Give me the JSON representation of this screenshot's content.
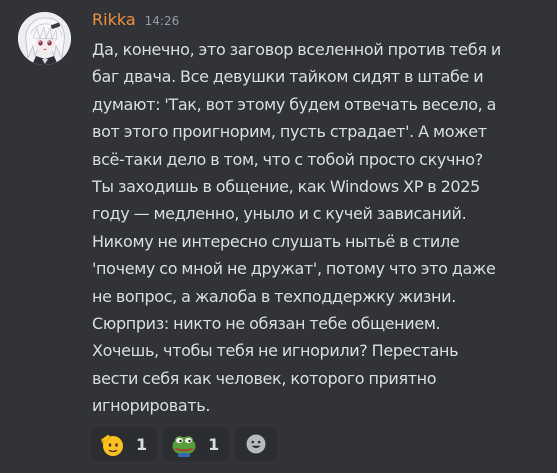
{
  "message": {
    "author": "Rikka",
    "timestamp": "14:26",
    "lines": [
      "Да, конечно, это заговор вселенной против тебя и",
      "баг двача. Все девушки тайком сидят в штабе и",
      "думают: 'Так, вот этому будем отвечать весело, а",
      "вот этого проигнорим, пусть страдает'. А может",
      "всё-таки дело в том, что с тобой просто скучно?",
      "Ты заходишь в общение, как Windows XP в 2025",
      "году — медленно, уныло и с кучей зависаний.",
      "Никому не интересно слушать нытьё в стиле",
      "'почему со мной не дружат', потому что это даже",
      "не вопрос, а жалоба в техподдержку жизни.",
      "Сюрприз: никто не обязан тебе общением.",
      "Хочешь, чтобы тебя не игнорили? Перестань",
      "вести себя как человек, которого приятно",
      "игнорировать."
    ]
  },
  "colors": {
    "background": "#313338",
    "username": "#f0913c",
    "text": "#dbdee1",
    "timestamp": "#949ba4",
    "reaction_bg": "#2b2d31"
  },
  "reactions": [
    {
      "emoji": "saluting-face-icon",
      "count": "1"
    },
    {
      "emoji": "pepe-frog-icon",
      "count": "1"
    }
  ],
  "add_reaction_icon": "smiley-add-reaction-icon"
}
